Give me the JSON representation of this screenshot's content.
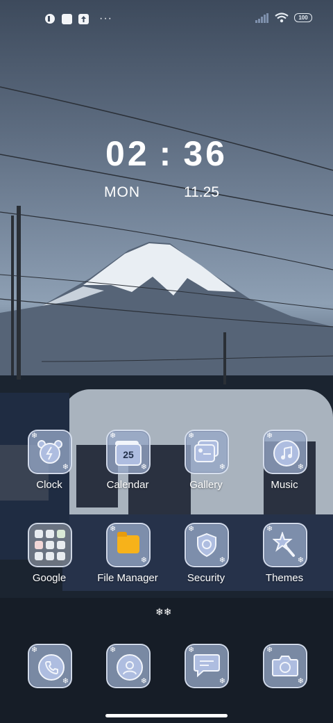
{
  "status_bar": {
    "battery_level": "100",
    "more_label": "···"
  },
  "lock": {
    "hour": "02",
    "colon": ":",
    "minute": "36",
    "day": "MON",
    "date": "11.25"
  },
  "apps": [
    {
      "label": "Clock",
      "icon": "alarm-clock-icon"
    },
    {
      "label": "Calendar",
      "icon": "calendar-icon",
      "badge": "25"
    },
    {
      "label": "Gallery",
      "icon": "gallery-icon"
    },
    {
      "label": "Music",
      "icon": "music-note-icon"
    },
    {
      "label": "Google",
      "icon": "google-folder-icon"
    },
    {
      "label": "File Manager",
      "icon": "folder-icon"
    },
    {
      "label": "Security",
      "icon": "shield-icon"
    },
    {
      "label": "Themes",
      "icon": "star-wand-icon"
    }
  ],
  "page_indicator": "❄❄",
  "dock": [
    {
      "icon": "phone-icon"
    },
    {
      "icon": "contacts-icon"
    },
    {
      "icon": "messages-icon"
    },
    {
      "icon": "camera-icon"
    }
  ],
  "colors": {
    "tile_bg": "#96a8c6",
    "icon_fill": "#aebde0",
    "folder": "#f7b21a"
  }
}
